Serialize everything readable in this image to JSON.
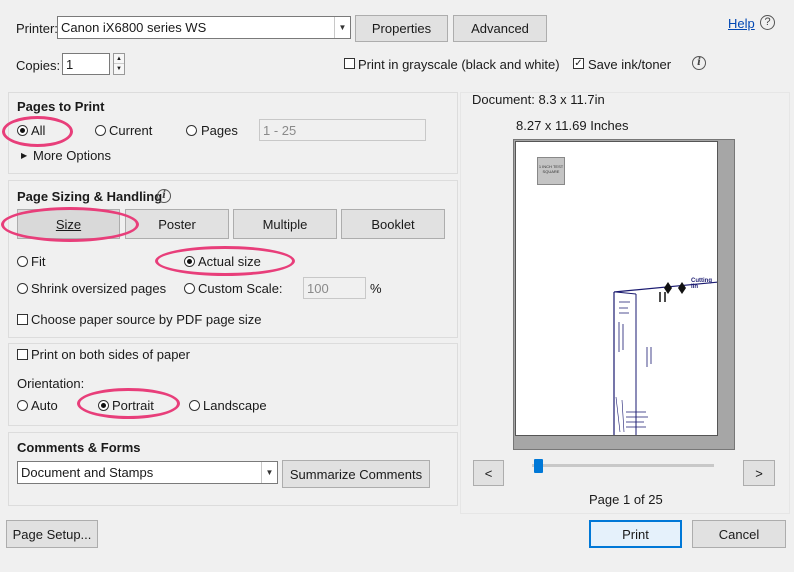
{
  "header": {
    "printer_label": "Printer:",
    "printer_value": "Canon iX6800 series WS",
    "properties_label": "Properties",
    "advanced_label": "Advanced",
    "help_label": "Help",
    "copies_label": "Copies:",
    "copies_value": "1",
    "grayscale_label": "Print in grayscale (black and white)",
    "grayscale_checked": false,
    "save_ink_label": "Save ink/toner",
    "save_ink_checked": true
  },
  "pages_to_print": {
    "title": "Pages to Print",
    "options": [
      "All",
      "Current",
      "Pages"
    ],
    "selected": "All",
    "pages_range": "1 - 25",
    "more_options": "More Options"
  },
  "sizing": {
    "title": "Page Sizing & Handling",
    "tabs": [
      "Size",
      "Poster",
      "Multiple",
      "Booklet"
    ],
    "active_tab": "Size",
    "fit_label": "Fit",
    "actual_size_label": "Actual size",
    "shrink_label": "Shrink oversized pages",
    "custom_scale_label": "Custom Scale:",
    "custom_scale_value": "100",
    "percent": "%",
    "paper_source_label": "Choose paper source by PDF page size"
  },
  "duplex": {
    "both_sides_label": "Print on both sides of paper",
    "orientation_label": "Orientation:",
    "options": [
      "Auto",
      "Portrait",
      "Landscape"
    ],
    "selected": "Portrait"
  },
  "comments": {
    "title": "Comments & Forms",
    "value": "Document and Stamps",
    "summarize_label": "Summarize Comments"
  },
  "preview": {
    "document_size": "Document: 8.3 x 11.7in",
    "paper_size": "8.27 x 11.69 Inches",
    "stamp_text": "1 INCH TEST SQUARE",
    "cutting_text": "Cutting lin",
    "page_status": "Page 1 of 25",
    "prev_label": "<",
    "next_label": ">"
  },
  "footer": {
    "page_setup_label": "Page Setup...",
    "print_label": "Print",
    "cancel_label": "Cancel"
  },
  "colors": {
    "highlight": "#e83e7a",
    "accent": "#0078d7",
    "link": "#0047b3"
  }
}
